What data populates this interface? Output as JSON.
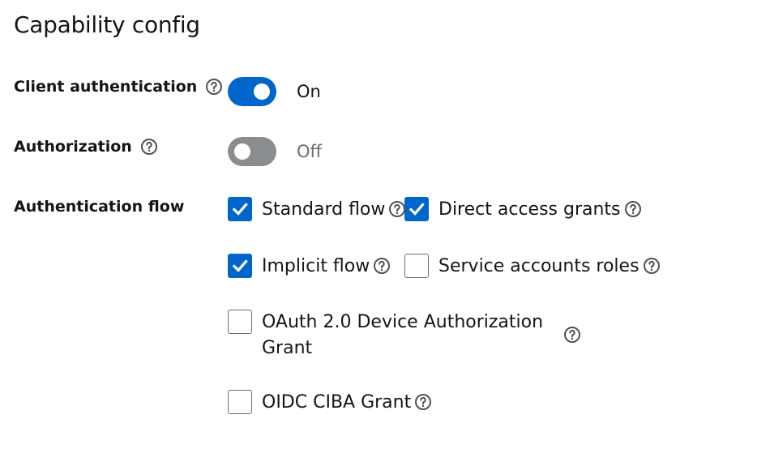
{
  "section": {
    "title": "Capability config"
  },
  "fields": {
    "client_authentication": {
      "label": "Client authentication",
      "state_text": "On",
      "enabled": true
    },
    "authorization": {
      "label": "Authorization",
      "state_text": "Off",
      "enabled": false
    },
    "authentication_flow": {
      "label": "Authentication flow",
      "options": [
        {
          "label": "Standard flow",
          "checked": true
        },
        {
          "label": "Direct access grants",
          "checked": true
        },
        {
          "label": "Implicit flow",
          "checked": true
        },
        {
          "label": "Service accounts roles",
          "checked": false
        },
        {
          "label_line1": "OAuth 2.0 Device Authorization",
          "label_line2": "Grant",
          "checked": false
        },
        {
          "label": "OIDC CIBA Grant",
          "checked": false
        }
      ]
    }
  },
  "colors": {
    "accent": "#0066cc",
    "switch_off": "#8a8d90",
    "text": "#151515",
    "muted_text": "#6a6e73"
  },
  "icons": {
    "help": "help-circle-icon",
    "check": "checkmark-icon"
  }
}
